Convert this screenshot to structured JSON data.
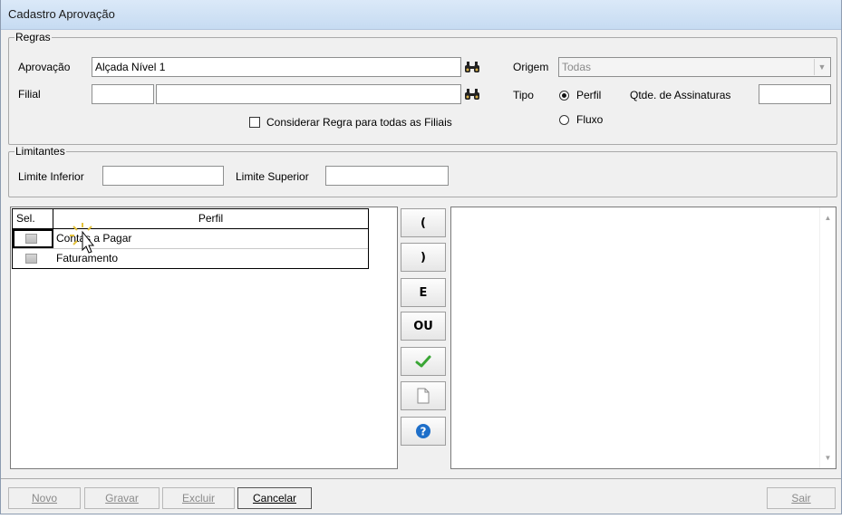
{
  "window": {
    "title": "Cadastro Aprovação"
  },
  "regras": {
    "legend": "Regras",
    "aprovacao": {
      "label": "Aprovação",
      "value": "Alçada Nível 1"
    },
    "filial": {
      "label": "Filial",
      "code": "",
      "name": ""
    },
    "origem": {
      "label": "Origem",
      "value": "Todas"
    },
    "tipo": {
      "label": "Tipo",
      "options": [
        "Perfil",
        "Fluxo"
      ],
      "selected": "Perfil"
    },
    "qtde_assinaturas": {
      "label": "Qtde. de Assinaturas",
      "value": ""
    },
    "considerar": {
      "label": "Considerar Regra para todas as Filiais",
      "checked": false
    }
  },
  "limitantes": {
    "legend": "Limitantes",
    "inferior": {
      "label": "Limite Inferior",
      "value": ""
    },
    "superior": {
      "label": "Limite Superior",
      "value": ""
    }
  },
  "grid": {
    "columns": [
      "Sel.",
      "Perfil"
    ],
    "rows": [
      {
        "perfil": "Contas a Pagar",
        "selected": false
      },
      {
        "perfil": "Faturamento",
        "selected": false
      }
    ]
  },
  "operators": {
    "open_paren": "(",
    "close_paren": ")",
    "and": "E",
    "or": "OU",
    "icons": [
      "check-icon",
      "blank-document-icon",
      "help-icon"
    ],
    "check_color": "#3aa635",
    "help_color": "#1e6fc9"
  },
  "buttons": {
    "novo": "Novo",
    "gravar": "Gravar",
    "excluir": "Excluir",
    "cancelar": "Cancelar",
    "sair": "Sair"
  }
}
